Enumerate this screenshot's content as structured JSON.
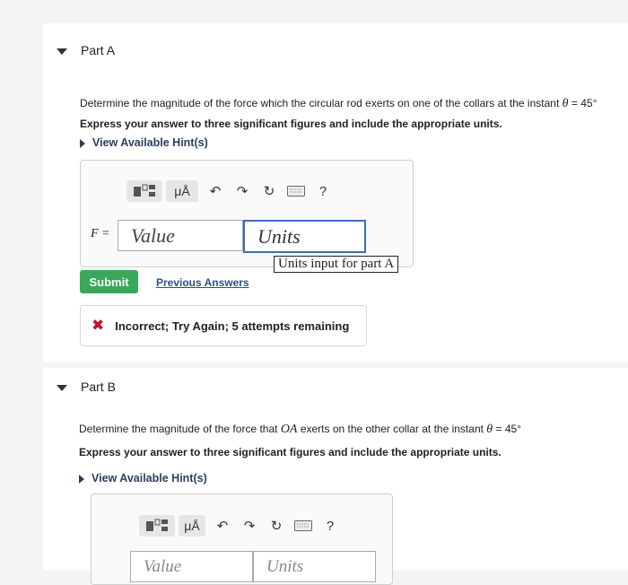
{
  "partA": {
    "title": "Part A",
    "question": "Determine the magnitude of the force which the circular rod exerts on one of the collars at the instant",
    "theta_symbol": "θ",
    "theta_value": "= 45°",
    "instruction": "Express your answer to three significant figures and include the appropriate units.",
    "hint_link": "View Available Hint(s)",
    "toolbar": {
      "templates_icon": "templates-icon",
      "units_symbol": "μÅ",
      "undo_icon": "undo-icon",
      "redo_icon": "redo-icon",
      "reset_icon": "reset-icon",
      "keyboard_icon": "keyboard-icon",
      "help_label": "?"
    },
    "variable_label": "F =",
    "value_placeholder": "Value",
    "units_placeholder": "Units",
    "units_tooltip": "Units input for part A",
    "submit_label": "Submit",
    "previous_answers_label": "Previous Answers",
    "feedback": "Incorrect; Try Again; 5 attempts remaining",
    "status_color": "#c8102e",
    "submit_color": "#39a85a"
  },
  "partB": {
    "title": "Part B",
    "question_pre": "Determine the magnitude of the force that",
    "question_var": "OA",
    "question_post": "exerts on the other collar at the instant",
    "theta_symbol": "θ",
    "theta_value": "= 45°",
    "instruction": "Express your answer to three significant figures and include the appropriate units.",
    "hint_link": "View Available Hint(s)",
    "toolbar": {
      "units_symbol": "μÅ",
      "help_label": "?"
    },
    "value_placeholder": "Value",
    "units_placeholder": "Units"
  }
}
